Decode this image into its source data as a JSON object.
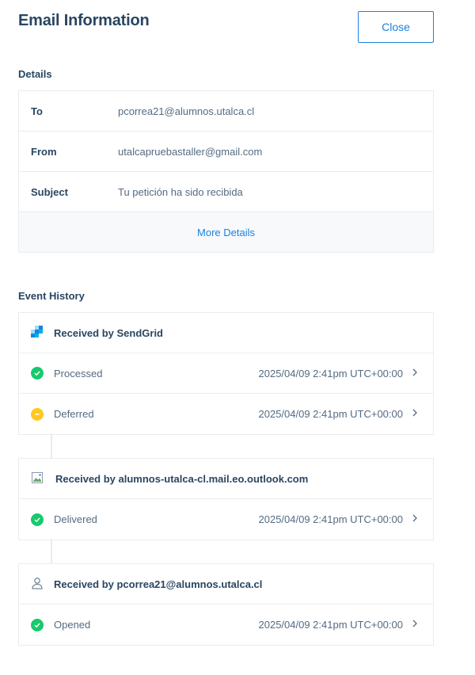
{
  "header": {
    "title": "Email Information",
    "close_label": "Close"
  },
  "details": {
    "section_title": "Details",
    "rows": [
      {
        "label": "To",
        "value": "pcorrea21@alumnos.utalca.cl"
      },
      {
        "label": "From",
        "value": "utalcapruebastaller@gmail.com"
      },
      {
        "label": "Subject",
        "value": "Tu petición ha sido recibida"
      }
    ],
    "more_label": "More Details"
  },
  "event_history": {
    "section_title": "Event History",
    "groups": [
      {
        "title": "Received by SendGrid",
        "icon": "sendgrid-logo-icon",
        "events": [
          {
            "name": "Processed",
            "time": "2025/04/09 2:41pm UTC+00:00",
            "status": "success",
            "icon": "check-circle-icon"
          },
          {
            "name": "Deferred",
            "time": "2025/04/09 2:41pm UTC+00:00",
            "status": "warning",
            "icon": "minus-circle-icon"
          }
        ]
      },
      {
        "title": "Received by alumnos-utalca-cl.mail.eo.outlook.com",
        "icon": "broken-image-icon",
        "events": [
          {
            "name": "Delivered",
            "time": "2025/04/09 2:41pm UTC+00:00",
            "status": "success",
            "icon": "check-circle-icon"
          }
        ]
      },
      {
        "title": "Received by pcorrea21@alumnos.utalca.cl",
        "icon": "user-icon",
        "events": [
          {
            "name": "Opened",
            "time": "2025/04/09 2:41pm UTC+00:00",
            "status": "success",
            "icon": "check-circle-icon"
          }
        ]
      }
    ]
  },
  "colors": {
    "accent": "#1a82e2",
    "success": "#18c96e",
    "warning": "#ffc820",
    "text_dark": "#294661",
    "text_muted": "#546b81",
    "border": "#e9ecef"
  }
}
